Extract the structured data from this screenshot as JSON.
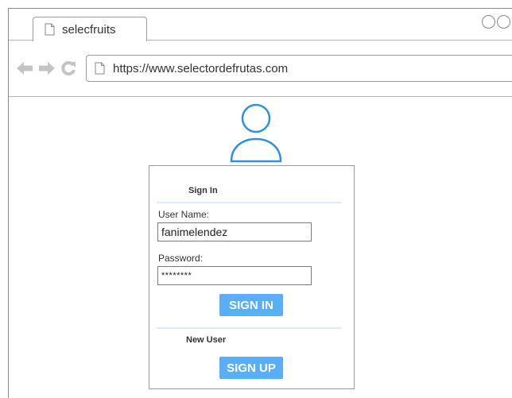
{
  "browser": {
    "tab_title": "selecfruits",
    "url": "https://www.selectordefrutas.com"
  },
  "signin": {
    "title": "Sign In",
    "username_label": "User Name:",
    "username_value": "fanimelendez",
    "password_label": "Password:",
    "password_value": "********",
    "signin_button": "SIGN IN"
  },
  "newuser": {
    "title": "New User",
    "signup_button": "SIGN UP"
  },
  "colors": {
    "accent": "#5aaef5",
    "icon_blue": "#2f8fe0",
    "separator": "#dce9f8"
  }
}
